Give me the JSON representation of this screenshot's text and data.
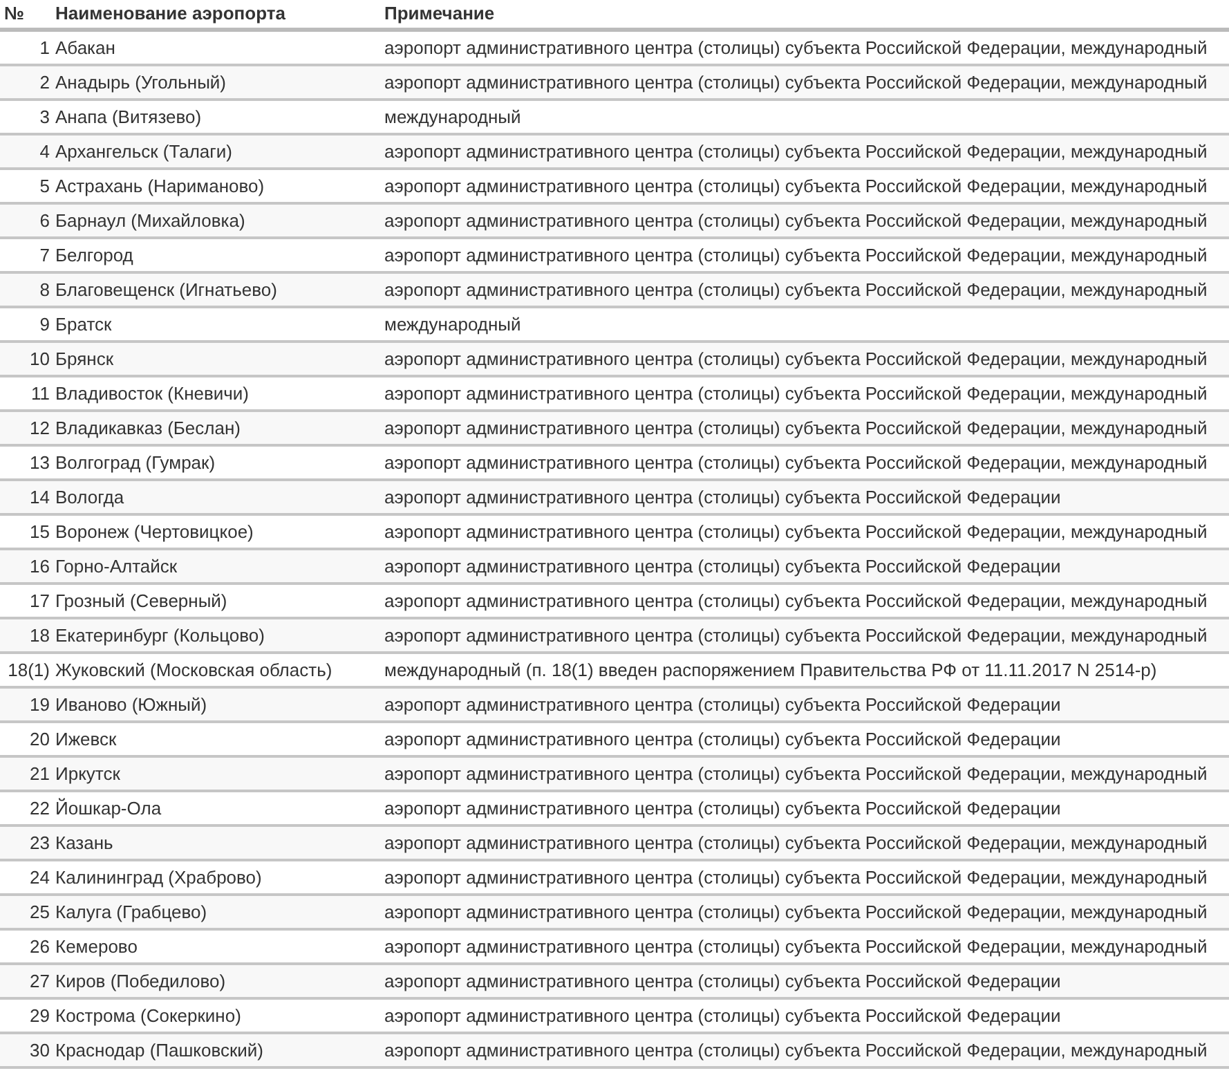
{
  "table": {
    "columns": [
      "№",
      "Наименование аэропорта",
      "Примечание"
    ],
    "rows": [
      [
        "1",
        "Абакан",
        "аэропорт административного центра (столицы) субъекта Российской Федерации, международный"
      ],
      [
        "2",
        "Анадырь (Угольный)",
        "аэропорт административного центра (столицы) субъекта Российской Федерации, международный"
      ],
      [
        "3",
        "Анапа (Витязево)",
        "международный"
      ],
      [
        "4",
        "Архангельск (Талаги)",
        "аэропорт административного центра (столицы) субъекта Российской Федерации, международный"
      ],
      [
        "5",
        "Астрахань (Нариманово)",
        "аэропорт административного центра (столицы) субъекта Российской Федерации, международный"
      ],
      [
        "6",
        "Барнаул (Михайловка)",
        "аэропорт административного центра (столицы) субъекта Российской Федерации, международный"
      ],
      [
        "7",
        "Белгород",
        "аэропорт административного центра (столицы) субъекта Российской Федерации, международный"
      ],
      [
        "8",
        "Благовещенск (Игнатьево)",
        "аэропорт административного центра (столицы) субъекта Российской Федерации, международный"
      ],
      [
        "9",
        "Братск",
        "международный"
      ],
      [
        "10",
        "Брянск",
        "аэропорт административного центра (столицы) субъекта Российской Федерации, международный"
      ],
      [
        "11",
        "Владивосток (Кневичи)",
        "аэропорт административного центра (столицы) субъекта Российской Федерации, международный"
      ],
      [
        "12",
        "Владикавказ (Беслан)",
        "аэропорт административного центра (столицы) субъекта Российской Федерации, международный"
      ],
      [
        "13",
        "Волгоград (Гумрак)",
        "аэропорт административного центра (столицы) субъекта Российской Федерации, международный"
      ],
      [
        "14",
        "Вологда",
        "аэропорт административного центра (столицы) субъекта Российской Федерации"
      ],
      [
        "15",
        "Воронеж (Чертовицкое)",
        "аэропорт административного центра (столицы) субъекта Российской Федерации, международный"
      ],
      [
        "16",
        "Горно-Алтайск",
        "аэропорт административного центра (столицы) субъекта Российской Федерации"
      ],
      [
        "17",
        "Грозный (Северный)",
        "аэропорт административного центра (столицы) субъекта Российской Федерации, международный"
      ],
      [
        "18",
        "Екатеринбург (Кольцово)",
        "аэропорт административного центра (столицы) субъекта Российской Федерации, международный"
      ],
      [
        "18(1)",
        "Жуковский (Московская область)",
        "международный (п. 18(1) введен распоряжением Правительства РФ от 11.11.2017 N 2514-р)"
      ],
      [
        "19",
        "Иваново (Южный)",
        "аэропорт административного центра (столицы) субъекта Российской Федерации"
      ],
      [
        "20",
        "Ижевск",
        "аэропорт административного центра (столицы) субъекта Российской Федерации"
      ],
      [
        "21",
        "Иркутск",
        "аэропорт административного центра (столицы) субъекта Российской Федерации, международный"
      ],
      [
        "22",
        "Йошкар-Ола",
        "аэропорт административного центра (столицы) субъекта Российской Федерации"
      ],
      [
        "23",
        "Казань",
        "аэропорт административного центра (столицы) субъекта Российской Федерации, международный"
      ],
      [
        "24",
        "Калининград (Храброво)",
        "аэропорт административного центра (столицы) субъекта Российской Федерации, международный"
      ],
      [
        "25",
        "Калуга (Грабцево)",
        "аэропорт административного центра (столицы) субъекта Российской Федерации, международный"
      ],
      [
        "26",
        "Кемерово",
        "аэропорт административного центра (столицы) субъекта Российской Федерации, международный"
      ],
      [
        "27",
        "Киров (Победилово)",
        "аэропорт административного центра (столицы) субъекта Российской Федерации"
      ],
      [
        "29",
        "Кострома (Сокеркино)",
        "аэропорт административного центра (столицы) субъекта Российской Федерации"
      ],
      [
        "30",
        "Краснодар (Пашковский)",
        "аэропорт административного центра (столицы) субъекта Российской Федерации, международный"
      ]
    ]
  }
}
